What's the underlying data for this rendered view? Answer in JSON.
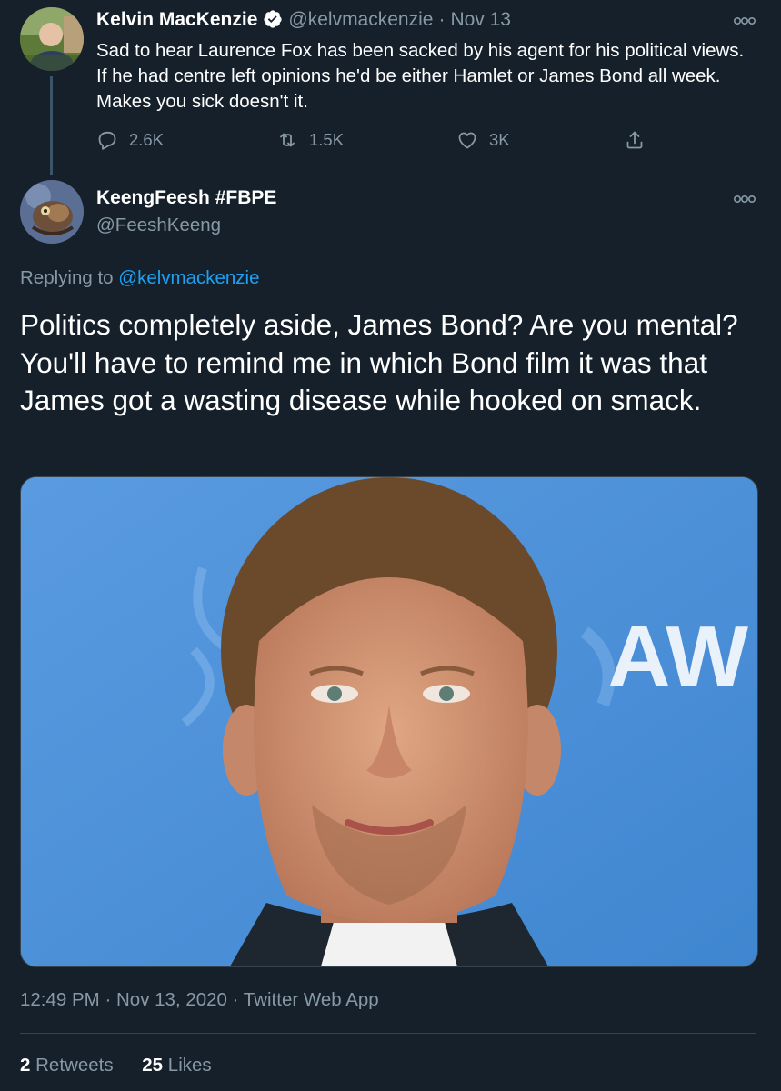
{
  "tweet1": {
    "name": "Kelvin MacKenzie",
    "handle": "@kelvmackenzie",
    "separator": "·",
    "date": "Nov 13",
    "text": "Sad to hear Laurence Fox has been sacked by his agent for his political views. If he had centre left opinions he'd be either Hamlet or James Bond all week. Makes you sick doesn't it.",
    "replies": "2.6K",
    "retweets": "1.5K",
    "likes": "3K",
    "icons": [
      "reply-icon",
      "retweet-icon",
      "like-icon",
      "share-icon",
      "more-icon",
      "verified-badge-icon"
    ]
  },
  "tweet2": {
    "name": "KeengFeesh #FBPE",
    "handle": "@FeeshKeeng",
    "replying_prefix": "Replying to ",
    "replying_to": "@kelvmackenzie",
    "text": "Politics completely aside, James Bond? Are you mental? You'll have to remind me in which Bond film it was that James got a wasting disease while hooked on smack.",
    "photo_text": "AW",
    "time": "12:49 PM",
    "date": "Nov 13, 2020",
    "separator": "·",
    "source": "Twitter Web App",
    "retweet_count": "2",
    "retweet_label": "Retweets",
    "like_count": "25",
    "like_label": "Likes"
  },
  "colors": {
    "background": "#15202b",
    "secondary_text": "#8899a6",
    "link": "#1da1f2",
    "border": "#38444d",
    "photo_backdrop": "#4b8fd4"
  }
}
